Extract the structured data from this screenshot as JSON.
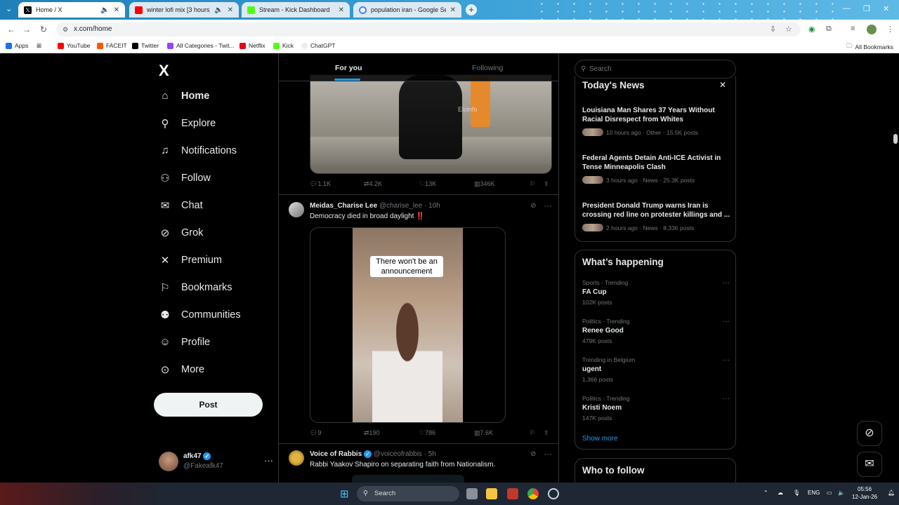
{
  "browser": {
    "tabs": [
      {
        "title": "Home / X",
        "color": "#000000"
      },
      {
        "title": "winter lofi mix [3 hours]",
        "color": "#ff0000"
      },
      {
        "title": "Stream - Kick Dashboard",
        "color": "#53fc18"
      },
      {
        "title": "population iran - Google Search",
        "color": "#4285f4"
      }
    ],
    "add_tab": "+",
    "url": "x.com/home",
    "bookmarks": [
      {
        "label": "Apps"
      },
      {
        "label": "YouTube"
      },
      {
        "label": "FACEIT"
      },
      {
        "label": "Twitter"
      },
      {
        "label": "All Categories - Twit..."
      },
      {
        "label": "Netflix"
      },
      {
        "label": "Kick"
      },
      {
        "label": "ChatGPT"
      }
    ],
    "all_bookmarks": "All Bookmarks"
  },
  "sidebar": {
    "logo": "X",
    "items": [
      {
        "label": "Home",
        "icon": "home-icon"
      },
      {
        "label": "Explore",
        "icon": "search-icon"
      },
      {
        "label": "Notifications",
        "icon": "bell-icon"
      },
      {
        "label": "Follow",
        "icon": "person-add-icon"
      },
      {
        "label": "Chat",
        "icon": "mail-icon"
      },
      {
        "label": "Grok",
        "icon": "grok-icon"
      },
      {
        "label": "Premium",
        "icon": "x-icon"
      },
      {
        "label": "Bookmarks",
        "icon": "bookmark-icon"
      },
      {
        "label": "Communities",
        "icon": "people-icon"
      },
      {
        "label": "Profile",
        "icon": "person-icon"
      },
      {
        "label": "More",
        "icon": "more-icon"
      }
    ],
    "post_button": "Post",
    "account": {
      "name": "afk47",
      "handle": "@Fakeafk47"
    }
  },
  "feed": {
    "tabs": [
      {
        "label": "For you"
      },
      {
        "label": "Following"
      }
    ],
    "post1_actions": {
      "replies": "1.1K",
      "reposts": "4.2K",
      "likes": "13K",
      "views": "346K"
    },
    "post1_watermark": "Eloinfo",
    "post2": {
      "name": "Meidas_Charise Lee",
      "handle": "@charise_lee",
      "time": "· 10h",
      "text": "Democracy died in broad daylight ‼️",
      "caption": "There won't be an announcement",
      "actions": {
        "replies": "9",
        "reposts": "190",
        "likes": "786",
        "views": "7.6K"
      }
    },
    "post3": {
      "name": "Voice of Rabbis",
      "handle": "@voiceofrabbis",
      "time": "· 5h",
      "text": "Rabbi Yaakov Shapiro on separating faith from Nationalism."
    }
  },
  "right": {
    "search_placeholder": "Search",
    "news": {
      "title": "Today's News",
      "items": [
        {
          "title": "Louisiana Man Shares 37 Years Without Racial Disrespect from Whites",
          "meta": "10 hours ago · Other · 15.5K posts"
        },
        {
          "title": "Federal Agents Detain Anti-ICE Activist in Tense Minneapolis Clash",
          "meta": "3 hours ago · News · 25.3K posts"
        },
        {
          "title": "President Donald Trump warns Iran is crossing red line on protester killings and ...",
          "meta": "2 hours ago · News · 8,336 posts"
        }
      ]
    },
    "happening": {
      "title": "What’s happening",
      "items": [
        {
          "category": "Sports · Trending",
          "name": "FA Cup",
          "posts": "102K posts"
        },
        {
          "category": "Politics · Trending",
          "name": "Renee Good",
          "posts": "479K posts"
        },
        {
          "category": "Trending in Belgium",
          "name": "ugent",
          "posts": "1,366 posts"
        },
        {
          "category": "Politics · Trending",
          "name": "Kristi Noem",
          "posts": "147K posts"
        }
      ],
      "show_more": "Show more"
    },
    "who_to_follow": "Who to follow"
  },
  "taskbar": {
    "search": "Search",
    "lang": "ENG",
    "time": "05:56",
    "date": "12-Jan-26"
  }
}
